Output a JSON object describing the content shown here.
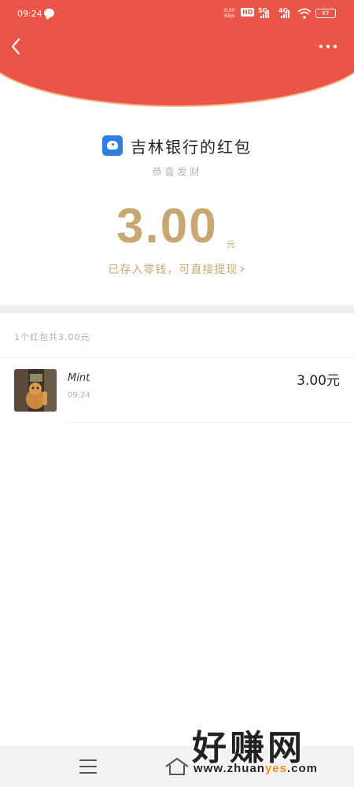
{
  "status_bar": {
    "time": "09:24",
    "speed_value": "0.00",
    "speed_unit": "KB/s",
    "hd_badge": "HD",
    "network_1": "5G",
    "network_2": "4G",
    "battery": "87"
  },
  "header": {
    "back_icon": "chevron-left-icon",
    "more_icon": "more-dots-icon"
  },
  "envelope": {
    "title": "吉林银行的红包",
    "greeting": "恭喜发财",
    "amount": "3.00",
    "amount_unit": "元",
    "saved_text": "已存入零钱，可直接提现",
    "saved_chevron": "›"
  },
  "summary": "1个红包共3.00元",
  "records": [
    {
      "name": "Mint",
      "time": "09:24",
      "amount": "3.00元"
    }
  ],
  "watermark": {
    "big": "好赚网",
    "small_pre": "www.zhuan",
    "small_hl": "yes",
    "small_post": ".com"
  },
  "colors": {
    "header_red": "#ec5448",
    "gold": "#c8a872",
    "bank_blue": "#2f7fe0"
  }
}
